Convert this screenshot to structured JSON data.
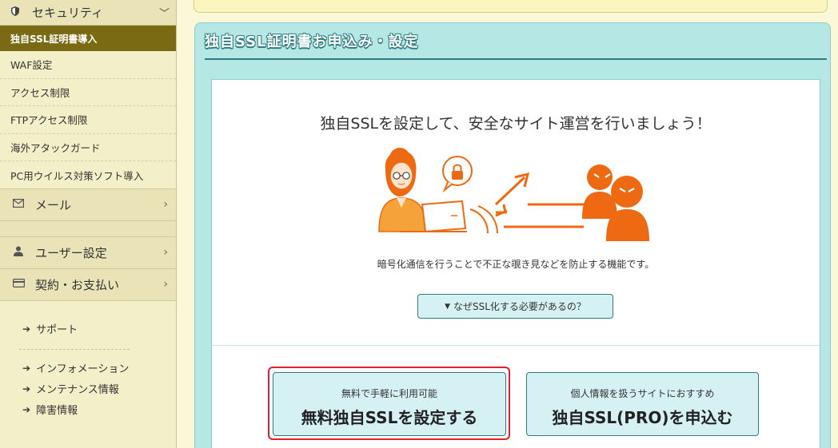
{
  "sidebar": {
    "security": {
      "label": "セキュリティ",
      "icon": "shield-icon"
    },
    "security_items": [
      {
        "label": "独自SSL証明書導入",
        "active": true
      },
      {
        "label": "WAF設定"
      },
      {
        "label": "アクセス制限"
      },
      {
        "label": "FTPアクセス制限"
      },
      {
        "label": "海外アタックガード"
      },
      {
        "label": "PC用ウイルス対策ソフト導入"
      }
    ],
    "mail": {
      "label": "メール",
      "icon": "envelope-icon"
    },
    "user_settings": {
      "label": "ユーザー設定",
      "icon": "user-icon"
    },
    "contract": {
      "label": "契約・お支払い",
      "icon": "credit-card-icon"
    },
    "links": [
      {
        "label": "サポート"
      },
      {
        "label": "インフォメーション"
      },
      {
        "label": "メンテナンス情報"
      },
      {
        "label": "障害情報"
      }
    ]
  },
  "main": {
    "panel_title": "独自SSL証明書お申込み・設定",
    "headline": "独自SSLを設定して、安全なサイト運営を行いましょう！",
    "description": "暗号化通信を行うことで不正な覗き見などを防止する機能です。",
    "why_button": "なぜSSL化する必要があるの？",
    "cta_free": {
      "sub": "無料で手軽に利用可能",
      "main": "無料独自SSLを設定する"
    },
    "cta_pro": {
      "sub": "個人情報を扱うサイトにおすすめ",
      "main": "独自SSL(PRO)を申込む"
    }
  },
  "colors": {
    "active_bg": "#7a6a14",
    "panel_bg": "#b5e7e5",
    "accent": "#2f7d82",
    "illustration_orange": "#ee6a12",
    "focus_red": "#e0202a"
  }
}
